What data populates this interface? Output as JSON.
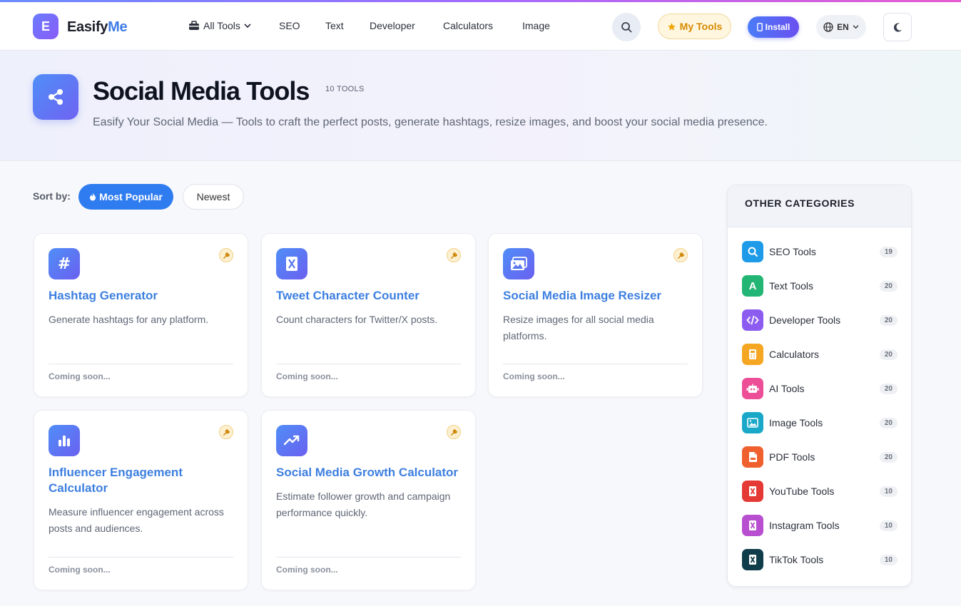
{
  "brand": {
    "logo_letter": "E",
    "name_part1": "Easify",
    "name_part2": "Me"
  },
  "nav": {
    "all_tools": "All Tools",
    "items": [
      "SEO",
      "Text",
      "Developer",
      "Calculators",
      "Image"
    ]
  },
  "header_actions": {
    "my_tools": "My Tools",
    "install": "Install",
    "language": "EN"
  },
  "hero": {
    "title": "Social Media Tools",
    "count": "10 TOOLS",
    "description": "Easify Your Social Media — Tools to craft the perfect posts, generate hashtags, resize images, and boost your social media presence."
  },
  "sort": {
    "label": "Sort by:",
    "popular": "Most Popular",
    "newest": "Newest"
  },
  "tools": [
    {
      "title": "Hashtag Generator",
      "description": "Generate hashtags for any platform.",
      "status": "Coming soon...",
      "icon": "hash-icon"
    },
    {
      "title": "Tweet Character Counter",
      "description": "Count characters for Twitter/X posts.",
      "status": "Coming soon...",
      "icon": "x-logo-icon"
    },
    {
      "title": "Social Media Image Resizer",
      "description": "Resize images for all social media platforms.",
      "status": "Coming soon...",
      "icon": "images-icon"
    },
    {
      "title": "Influencer Engagement Calculator",
      "description": "Measure influencer engagement across posts and audiences.",
      "status": "Coming soon...",
      "icon": "bar-chart-icon"
    },
    {
      "title": "Social Media Growth Calculator",
      "description": "Estimate follower growth and campaign performance quickly.",
      "status": "Coming soon...",
      "icon": "trend-up-icon"
    }
  ],
  "sidebar": {
    "title": "OTHER CATEGORIES",
    "categories": [
      {
        "label": "SEO Tools",
        "count": "19",
        "color": "#1e9be8",
        "icon": "seo-search-icon"
      },
      {
        "label": "Text Tools",
        "count": "20",
        "color": "#22b573",
        "icon": "text-a-icon"
      },
      {
        "label": "Developer Tools",
        "count": "20",
        "color": "#8c5cf0",
        "icon": "code-icon"
      },
      {
        "label": "Calculators",
        "count": "20",
        "color": "#f5a623",
        "icon": "calculator-icon"
      },
      {
        "label": "AI Tools",
        "count": "20",
        "color": "#ec4f98",
        "icon": "robot-icon"
      },
      {
        "label": "Image Tools",
        "count": "20",
        "color": "#1aa8c8",
        "icon": "image-icon"
      },
      {
        "label": "PDF Tools",
        "count": "20",
        "color": "#f0602f",
        "icon": "pdf-icon"
      },
      {
        "label": "YouTube Tools",
        "count": "10",
        "color": "#e53935",
        "icon": "youtube-icon"
      },
      {
        "label": "Instagram Tools",
        "count": "10",
        "color": "#b84fd0",
        "icon": "instagram-icon"
      },
      {
        "label": "TikTok Tools",
        "count": "10",
        "color": "#0f3d4a",
        "icon": "tiktok-icon"
      }
    ]
  }
}
